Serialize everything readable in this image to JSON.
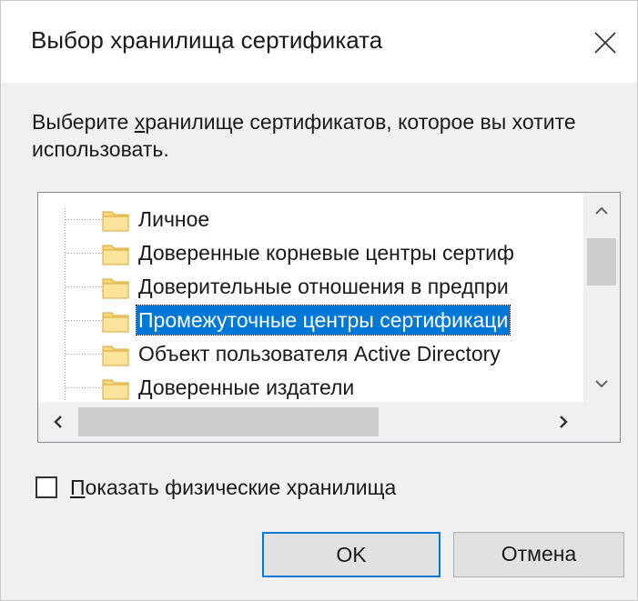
{
  "dialog": {
    "title": "Выбор хранилища сертификата",
    "close_icon": "close-icon"
  },
  "instruction": {
    "before": "Выберите ",
    "accel": "х",
    "after": "ранилище сертификатов, которое вы хотите использовать."
  },
  "tree": {
    "items": [
      {
        "label": "Личное",
        "icon": "folder-icon",
        "selected": false
      },
      {
        "label": "Доверенные корневые центры сертиф",
        "icon": "folder-icon",
        "selected": false
      },
      {
        "label": "Доверительные отношения в предпри",
        "icon": "folder-icon",
        "selected": false
      },
      {
        "label": "Промежуточные центры сертификаци",
        "icon": "folder-icon",
        "selected": true
      },
      {
        "label": "Объект пользователя Active Directory",
        "icon": "folder-icon",
        "selected": false
      },
      {
        "label": "Доверенные издатели",
        "icon": "folder-icon",
        "selected": false
      }
    ],
    "scroll_icons": {
      "up": "chevron-up-icon",
      "down": "chevron-down-icon",
      "left": "chevron-left-icon",
      "right": "chevron-right-icon"
    }
  },
  "checkbox": {
    "accel": "П",
    "label_rest": "оказать физические хранилища",
    "checked": false
  },
  "buttons": {
    "ok": "OK",
    "cancel": "Отмена"
  },
  "colors": {
    "selection": "#0078d7",
    "default_button_border": "#0078d7",
    "folder": "#f8d775"
  }
}
